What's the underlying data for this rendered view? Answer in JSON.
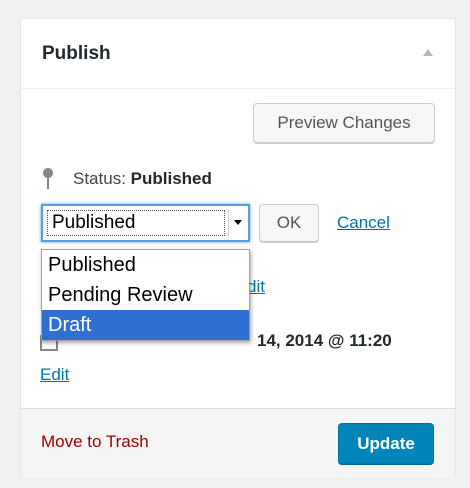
{
  "panel": {
    "title": "Publish",
    "toggle_icon": "triangle-up-icon"
  },
  "actions": {
    "preview_label": "Preview Changes"
  },
  "status": {
    "label": "Status: ",
    "value": "Published",
    "icon": "pin-icon"
  },
  "status_select": {
    "current_value": "Published",
    "options": [
      "Published",
      "Pending Review",
      "Draft"
    ],
    "highlighted_option": "Draft",
    "ok_label": "OK",
    "cancel_label": "Cancel"
  },
  "visibility": {
    "edit_partial": "dit"
  },
  "publish_date": {
    "text_partial": "14, 2014 @ 11:20",
    "edit_label": "Edit",
    "icon": "calendar-icon"
  },
  "footer": {
    "trash_label": "Move to Trash",
    "update_label": "Update"
  },
  "colors": {
    "link": "#0073aa",
    "trash": "#a00000",
    "primary_button": "#0085ba",
    "selected_option": "#2f6fd0",
    "focus_border": "#5b9dd9"
  }
}
